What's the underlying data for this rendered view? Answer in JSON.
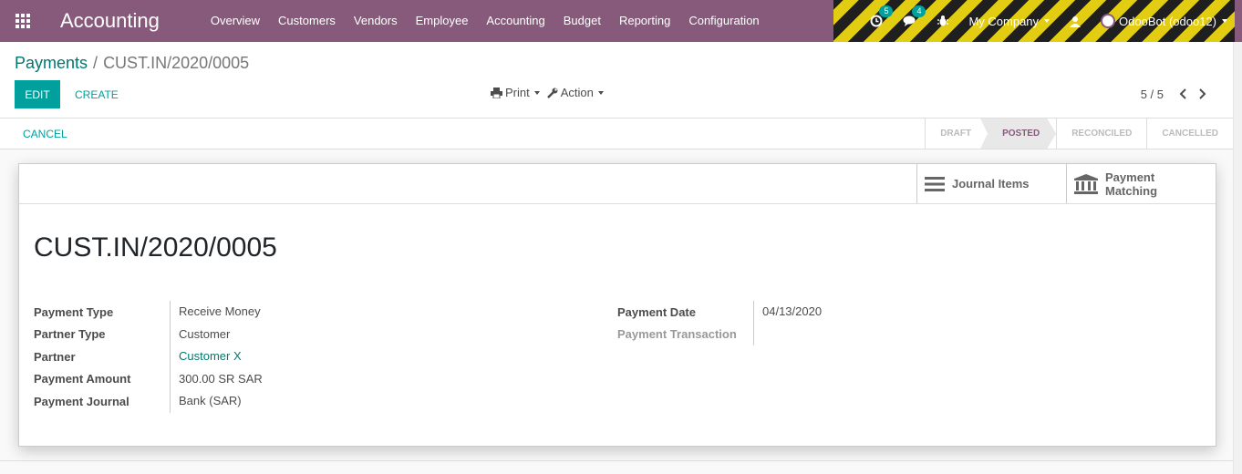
{
  "app": {
    "brand": "Accounting",
    "menu": [
      "Overview",
      "Customers",
      "Vendors",
      "Employee",
      "Accounting",
      "Budget",
      "Reporting",
      "Configuration"
    ]
  },
  "systray": {
    "activity_count": "5",
    "messages_count": "4",
    "company": "My Company",
    "user": "OdooBot (odoo12)"
  },
  "breadcrumb": {
    "parent": "Payments",
    "separator": "/",
    "current": "CUST.IN/2020/0005"
  },
  "buttons": {
    "edit": "EDIT",
    "create": "CREATE",
    "print": "Print",
    "action": "Action",
    "cancel": "CANCEL"
  },
  "pager": {
    "value": "5 / 5"
  },
  "stages": [
    "DRAFT",
    "POSTED",
    "RECONCILED",
    "CANCELLED"
  ],
  "active_stage": "POSTED",
  "smart_buttons": {
    "journal_items": "Journal Items",
    "payment_matching_1": "Payment",
    "payment_matching_2": "Matching"
  },
  "record": {
    "name": "CUST.IN/2020/0005",
    "left_fields": [
      {
        "label": "Payment Type",
        "value": "Receive Money"
      },
      {
        "label": "Partner Type",
        "value": "Customer"
      },
      {
        "label": "Partner",
        "value": "Customer X"
      },
      {
        "label": "Payment Amount",
        "value": "300.00 SR SAR"
      },
      {
        "label": "Payment Journal",
        "value": "Bank (SAR)"
      }
    ],
    "right_fields": [
      {
        "label": "Payment Date",
        "value": "04/13/2020"
      },
      {
        "label": "Payment Transaction",
        "value": ""
      }
    ]
  },
  "colors": {
    "navbar": "#875a7b",
    "primary": "#00a09d",
    "link": "#00786f"
  }
}
